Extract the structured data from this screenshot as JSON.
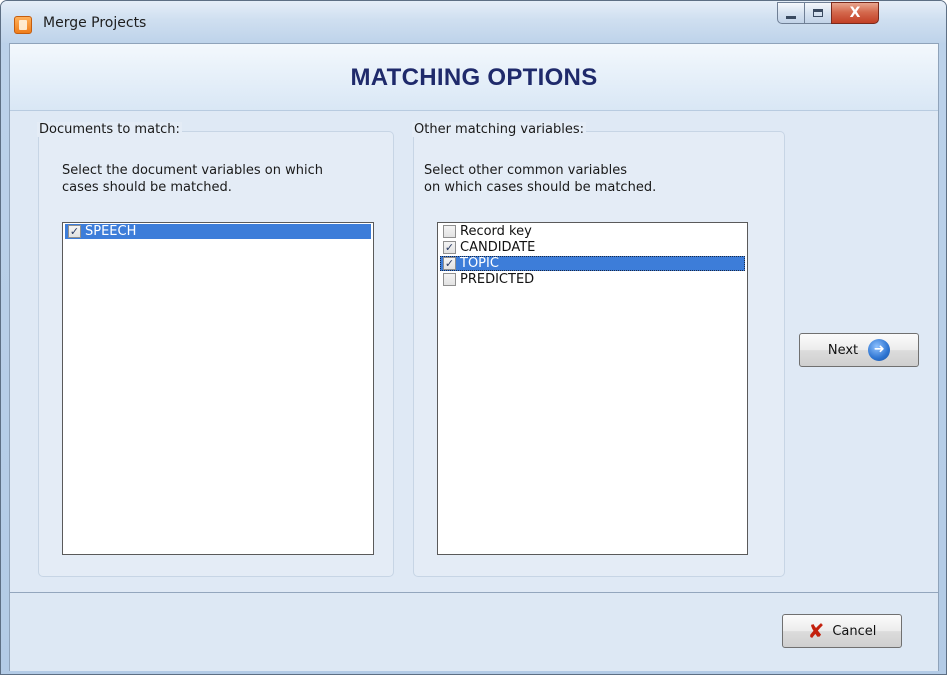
{
  "window": {
    "title": "Merge Projects",
    "app_icon": "merge-projects-app-icon",
    "controls": {
      "minimize_icon": "minimize-icon",
      "maximize_icon": "maximize-icon",
      "close_glyph": "X"
    }
  },
  "header": {
    "title": "MATCHING OPTIONS"
  },
  "documents_group": {
    "title": "Documents to match:",
    "description_line1": "Select the document variables on which",
    "description_line2": "cases should be matched.",
    "items": [
      {
        "label": "SPEECH",
        "checked": true,
        "selected": true
      }
    ]
  },
  "variables_group": {
    "title": "Other matching variables:",
    "description_line1": "Select other common variables",
    "description_line2": "on which cases should be matched.",
    "items": [
      {
        "label": "Record key",
        "checked": false,
        "selected": false
      },
      {
        "label": "CANDIDATE",
        "checked": true,
        "selected": false
      },
      {
        "label": "TOPIC",
        "checked": true,
        "selected": true
      },
      {
        "label": "PREDICTED",
        "checked": false,
        "selected": false
      }
    ]
  },
  "next_button": {
    "label": "Next",
    "icon": "next-arrow-icon"
  },
  "cancel_button": {
    "label": "Cancel",
    "icon": "cancel-x-icon"
  },
  "colors": {
    "header_title": "#1f2a6b",
    "selection": "#3d7dd9",
    "cancel_icon": "#c3200d",
    "close_button": "#c23f25"
  }
}
